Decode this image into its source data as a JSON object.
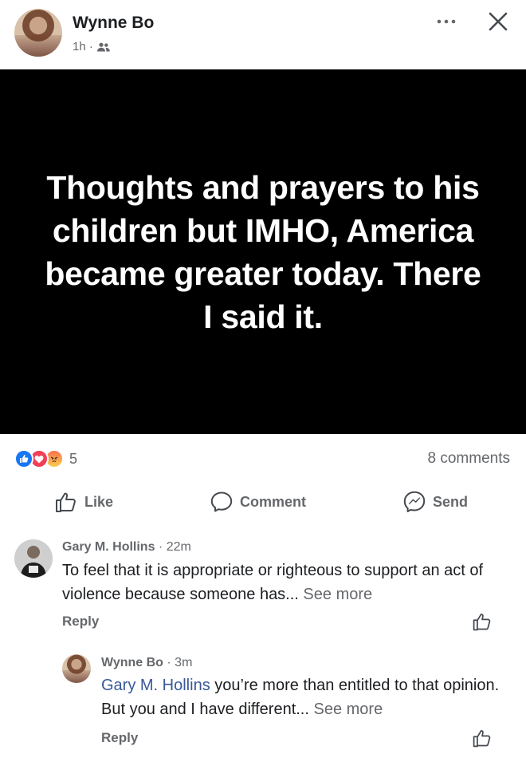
{
  "post": {
    "author": "Wynne Bo",
    "time": "1h ·",
    "image_text": "Thoughts and prayers to his children but IMHO, America became greater today. There I said it.",
    "reactions_count": "5",
    "comments_count": "8 comments"
  },
  "actions": {
    "like": "Like",
    "comment": "Comment",
    "send": "Send"
  },
  "comments": [
    {
      "author": "Gary M. Hollins",
      "time": "· 22m",
      "text": "To feel that it is appropriate or righteous to support an act of violence because someone has...",
      "see_more": "See more",
      "reply": "Reply"
    },
    {
      "author": "Wynne Bo",
      "time": "· 3m",
      "mention": "Gary M. Hollins",
      "text": " you’re more than entitled to that opinion. But you and I have different...",
      "see_more": "See more",
      "reply": "Reply"
    }
  ],
  "icons": {
    "more": "more-horizontal-icon",
    "close": "close-icon",
    "audience": "friends-icon",
    "like": "thumbs-up-icon",
    "comment": "speech-bubble-icon",
    "send": "messenger-icon",
    "reactions": [
      "like-reaction-icon",
      "love-reaction-icon",
      "angry-reaction-icon"
    ]
  },
  "colors": {
    "like_blue": "#1877f2",
    "love_red": "#f33e58",
    "angry_orange": "#f7714c",
    "mention_blue": "#385898",
    "secondary_text": "#65676b"
  }
}
